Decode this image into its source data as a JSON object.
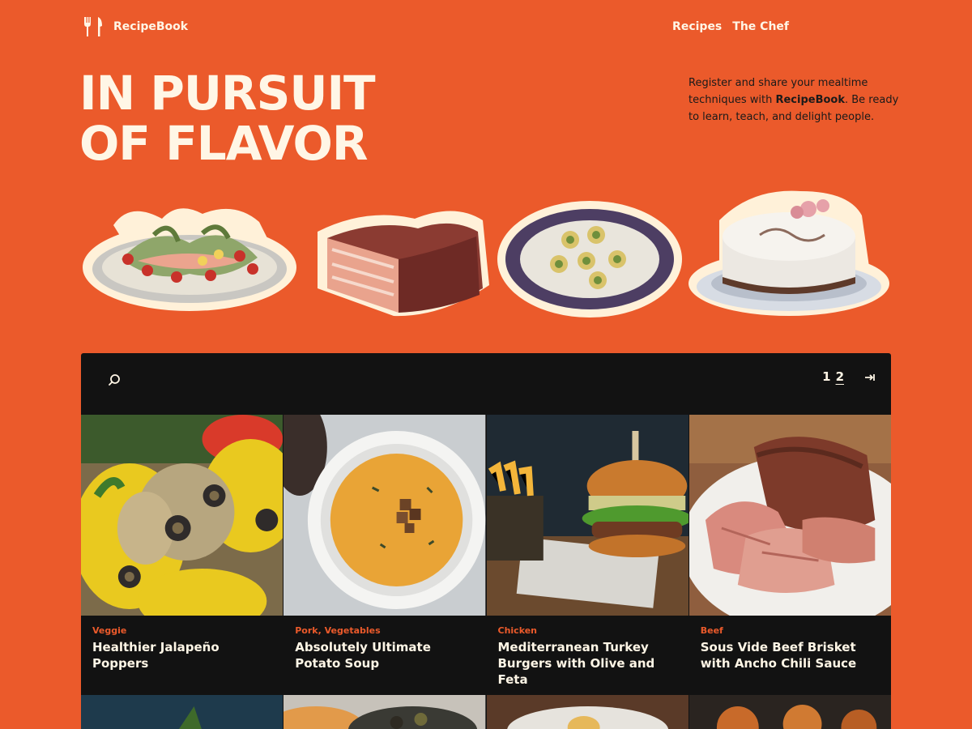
{
  "brand": {
    "name": "RecipeBook",
    "icon": "fork-knife-icon"
  },
  "nav": {
    "items": [
      {
        "label": "Recipes"
      },
      {
        "label": "The Chef"
      }
    ]
  },
  "hero": {
    "title_line1": "IN PURSUIT",
    "title_line2": "OF FLAVOR",
    "intro_pre": "Register and share your mealtime techniques with ",
    "intro_brand": "RecipeBook",
    "intro_post": ". Be ready to learn, teach, and delight people."
  },
  "stickers": [
    {
      "name": "salmon-platter-sticker"
    },
    {
      "name": "bacon-slab-sticker"
    },
    {
      "name": "canapes-plate-sticker"
    },
    {
      "name": "cake-sticker"
    }
  ],
  "toolbar": {
    "search_icon": "search-icon",
    "pages": [
      "1",
      "2"
    ],
    "current_page": "2",
    "last_icon": "last-page-icon"
  },
  "recipes": [
    {
      "category": "Veggie",
      "title": "Healthier Jalapeño Poppers",
      "image": "stuffed-peppers"
    },
    {
      "category": "Pork, Vegetables",
      "title": "Absolutely Ultimate Potato Soup",
      "image": "potato-soup"
    },
    {
      "category": "Chicken",
      "title": "Mediterranean Turkey Burgers with Olive and Feta",
      "image": "burger-fries"
    },
    {
      "category": "Beef",
      "title": "Sous Vide Beef Brisket with Ancho Chili Sauce",
      "image": "sliced-brisket"
    }
  ],
  "colors": {
    "background": "#EB5A2B",
    "panel": "#121212",
    "cream": "#FFF6E6",
    "accent": "#EB5A2B"
  }
}
